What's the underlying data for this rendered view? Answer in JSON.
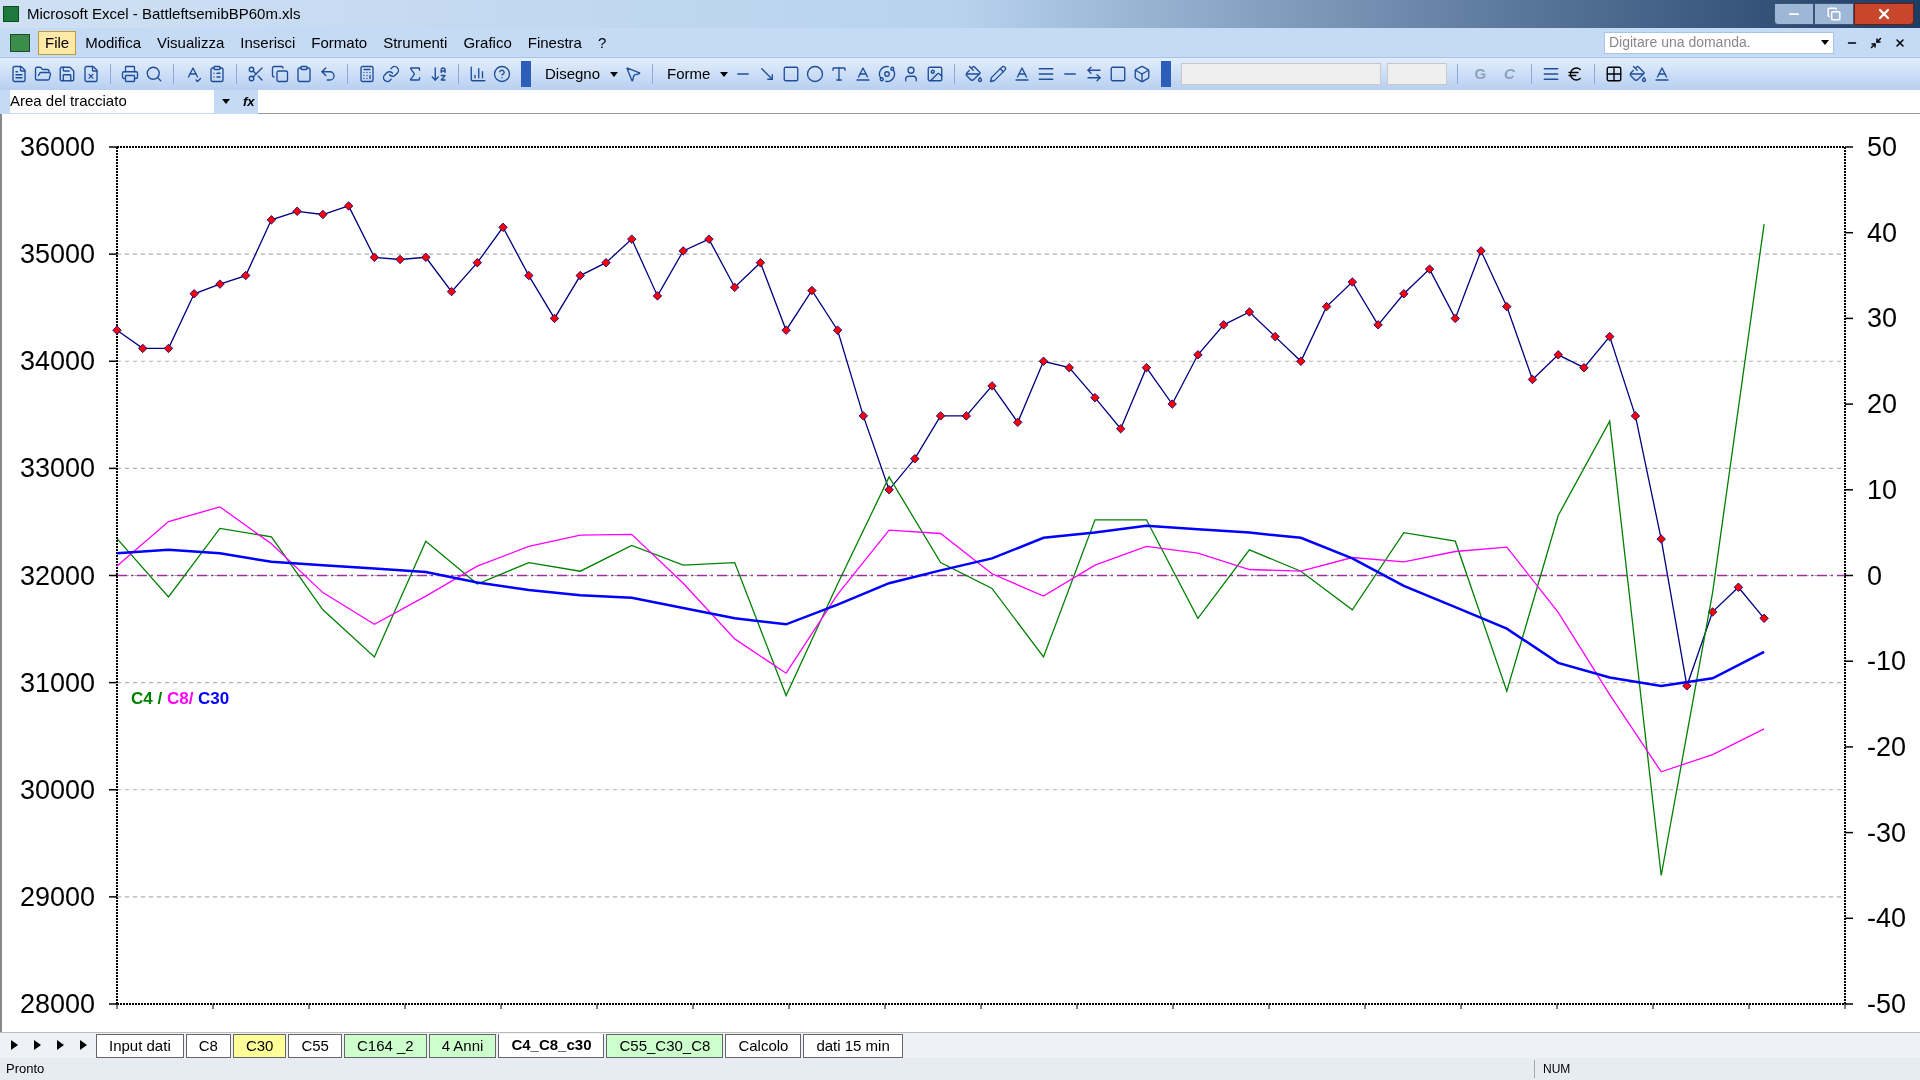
{
  "window": {
    "title": "Microsoft Excel - BattleftsemibBP60m.xls"
  },
  "menu": [
    {
      "label": "File",
      "selected": true
    },
    {
      "label": "Modifica",
      "selected": false
    },
    {
      "label": "Visualizza",
      "selected": false
    },
    {
      "label": "Inserisci",
      "selected": false
    },
    {
      "label": "Formato",
      "selected": false
    },
    {
      "label": "Strumenti",
      "selected": false
    },
    {
      "label": "Grafico",
      "selected": false
    },
    {
      "label": "Finestra",
      "selected": false
    },
    {
      "label": "?",
      "selected": false
    }
  ],
  "help_search": {
    "placeholder": "Digitare una domanda."
  },
  "toolbar": {
    "drawing_menus": [
      "Disegno",
      "Forme"
    ],
    "format_buttons": [
      "G",
      "C"
    ]
  },
  "name_box": {
    "value": "Area del tracciato"
  },
  "formula_label": "fx",
  "chart": {
    "legend_separators": [
      " / ",
      "/ "
    ],
    "price_chart": {
      "chart_data": {
        "type": "line",
        "ylim": [
          28000,
          36000
        ],
        "yticks": [
          {
            "value": 28000,
            "label": "28000"
          },
          {
            "value": 29000,
            "label": "29000"
          },
          {
            "value": 30000,
            "label": "30000"
          },
          {
            "value": 31000,
            "label": "31000"
          },
          {
            "value": 32000,
            "label": "32000"
          },
          {
            "value": 33000,
            "label": "33000"
          },
          {
            "value": 34000,
            "label": "34000"
          },
          {
            "value": 35000,
            "label": "35000"
          },
          {
            "value": 36000,
            "label": "36000"
          }
        ],
        "grid": true,
        "categories": [
          null,
          null,
          null,
          null,
          null,
          null,
          null,
          null,
          null,
          null,
          null,
          null,
          null,
          null,
          null,
          null,
          null,
          null,
          null,
          null,
          null,
          null,
          null,
          null,
          null,
          null,
          null,
          null,
          null,
          null,
          null,
          null,
          null,
          null,
          null,
          null,
          null,
          null,
          null,
          null,
          null,
          null,
          null,
          null,
          null,
          null,
          null,
          null,
          null,
          null,
          null,
          null,
          null,
          null,
          null,
          null,
          null,
          null,
          null,
          null,
          null,
          null,
          null,
          null,
          null
        ],
        "series": [
          {
            "color": "#000080",
            "marker": true,
            "values": [
              34290,
              34120,
              34120,
              34630,
              34720,
              34800,
              35320,
              35400,
              35370,
              35450,
              34970,
              34950,
              34970,
              34650,
              34920,
              35250,
              34800,
              34400,
              34800,
              34920,
              35140,
              34610,
              35030,
              35140,
              34690,
              34920,
              34290,
              34660,
              34290,
              33490,
              32800,
              33090,
              33490,
              33490,
              33770,
              33430,
              34000,
              33940,
              33660,
              33370,
              33940,
              33600,
              34060,
              34340,
              34460,
              34230,
              34000,
              34510,
              34740,
              34340,
              34630,
              34860,
              34400,
              35030,
              34510,
              33830,
              34060,
              33940,
              34230,
              33490,
              32340,
              30970,
              31660,
              31890,
              31600
            ]
          }
        ]
      }
    },
    "oscillator_chart": {
      "chart_data": {
        "type": "line",
        "ylim": [
          -50,
          50
        ],
        "yticks": [
          {
            "value": -50,
            "label": "-50"
          },
          {
            "value": -40,
            "label": "-40"
          },
          {
            "value": -30,
            "label": "-30"
          },
          {
            "value": -20,
            "label": "-20"
          },
          {
            "value": -10,
            "label": "-10"
          },
          {
            "value": 0,
            "label": "0"
          },
          {
            "value": 10,
            "label": "10"
          },
          {
            "value": 20,
            "label": "20"
          },
          {
            "value": 30,
            "label": "30"
          },
          {
            "value": 40,
            "label": "40"
          },
          {
            "value": 50,
            "label": "50"
          }
        ],
        "ref_lines": [
          {
            "axis": "y",
            "value": 0
          }
        ],
        "categories": [
          null,
          null,
          null,
          null,
          null,
          null,
          null,
          null,
          null,
          null,
          null,
          null,
          null,
          null,
          null,
          null,
          null,
          null,
          null,
          null,
          null,
          null,
          null,
          null,
          null,
          null,
          null,
          null,
          null,
          null,
          null,
          null,
          null
        ],
        "series": [
          {
            "name": "C4",
            "color": "#008000",
            "values": [
              4.3,
              -2.5,
              5.5,
              4.5,
              -4,
              -9.5,
              4,
              -1,
              1.5,
              0.5,
              3.5,
              1.2,
              1.5,
              -14,
              -1,
              11.5,
              1.5,
              -1.5,
              -9.5,
              6.5,
              6.5,
              -5,
              3,
              0.5,
              -4,
              5,
              4,
              -13.5,
              7,
              18,
              -35,
              -2,
              41
            ]
          },
          {
            "name": "C8",
            "color": "#ff00ff",
            "values": [
              1.1,
              6.3,
              8,
              3.7,
              -2,
              -5.7,
              -2.4,
              1.1,
              3.4,
              4.7,
              4.8,
              -0.9,
              -7.4,
              -11.4,
              -2.2,
              5.3,
              4.9,
              0.2,
              -2.4,
              1.2,
              3.4,
              2.6,
              0.7,
              0.5,
              2.1,
              1.6,
              2.8,
              3.3,
              -4.3,
              -13.9,
              -22.9,
              -20.9,
              -17.9
            ]
          },
          {
            "name": "C30",
            "color": "#0000ff",
            "values": [
              2.6,
              3,
              2.6,
              1.6,
              1.2,
              0.8,
              0.4,
              -0.8,
              -1.7,
              -2.3,
              -2.6,
              -3.8,
              -5,
              -5.7,
              -3.4,
              -0.9,
              0.6,
              2,
              4.4,
              5,
              5.8,
              5.4,
              5,
              4.4,
              2,
              -1.2,
              -3.7,
              -6.2,
              -10.2,
              -11.9,
              -12.9,
              -12,
              -8.9
            ]
          }
        ]
      }
    }
  },
  "sheet_tabs": [
    {
      "label": "Input dati",
      "selected": false
    },
    {
      "label": "C8",
      "selected": false
    },
    {
      "label": "C30",
      "selected": false,
      "color": "#ffff99"
    },
    {
      "label": "C55",
      "selected": false
    },
    {
      "label": "C164 _2",
      "selected": false,
      "color": "#ccffcc"
    },
    {
      "label": "4 Anni",
      "selected": false,
      "color": "#ccffcc"
    },
    {
      "label": "C4_C8_c30",
      "selected": true
    },
    {
      "label": "C55_C30_C8",
      "selected": false,
      "color": "#ccffcc"
    },
    {
      "label": "Calcolo",
      "selected": false
    },
    {
      "label": "dati 15 min",
      "selected": false
    }
  ],
  "status_bar": {
    "text": "Pronto",
    "indicator": "NUM"
  }
}
